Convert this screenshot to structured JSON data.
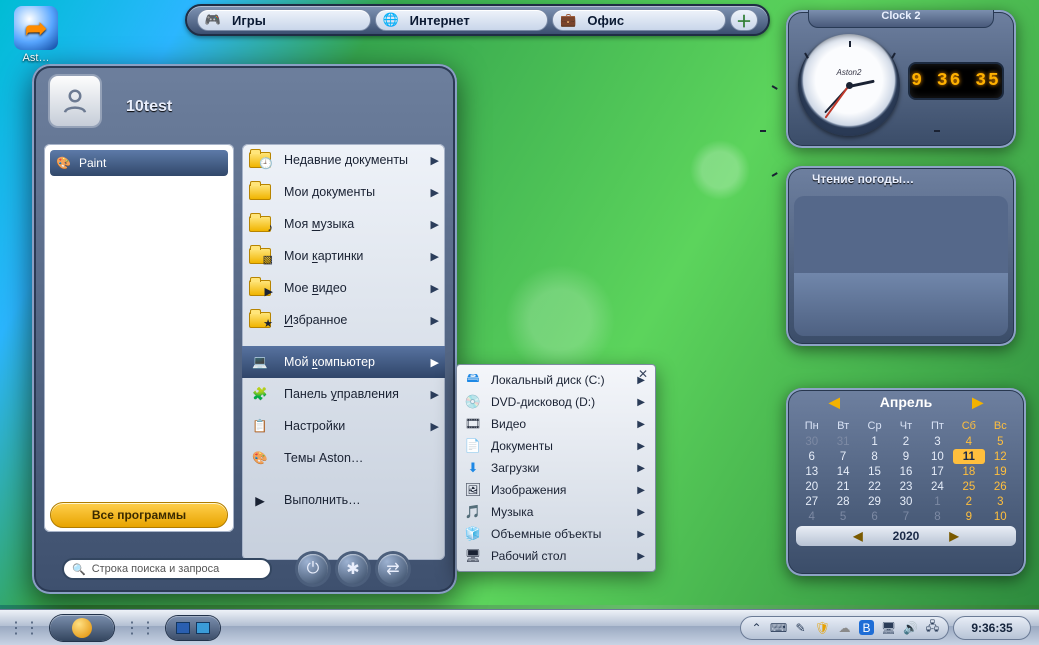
{
  "toolbar": {
    "items": [
      {
        "label": "Игры",
        "icon": "🎮"
      },
      {
        "label": "Интернет",
        "icon": "🌐"
      },
      {
        "label": "Офис",
        "icon": "💼"
      }
    ]
  },
  "desktop": {
    "icon0_label": "Ast…"
  },
  "start": {
    "username": "10test",
    "pinned": {
      "paint": "Paint"
    },
    "all_programs": "Все программы",
    "search_placeholder": "Строка поиска и запроса",
    "right": [
      {
        "label": "Недавние документы",
        "icon": "recent",
        "arrow": true
      },
      {
        "label": "Мои документы",
        "icon": "folder",
        "arrow": true
      },
      {
        "label": "Моя музыка",
        "u": "м",
        "rest": "узыка",
        "pre": "Моя ",
        "icon": "music",
        "arrow": true
      },
      {
        "label": "Мои картинки",
        "u": "к",
        "rest": "артинки",
        "pre": "Мои ",
        "icon": "pics",
        "arrow": true
      },
      {
        "label": "Мое видео",
        "u": "в",
        "rest": "идео",
        "pre": "Мое ",
        "icon": "video",
        "arrow": true
      },
      {
        "label": "Избранное",
        "u": "И",
        "rest": "збранное",
        "pre": "",
        "icon": "fav",
        "arrow": true
      },
      {
        "label": "Мой компьютер",
        "u": "к",
        "rest": "омпьютер",
        "pre": "Мой ",
        "icon": "pc",
        "arrow": true,
        "selected": true
      },
      {
        "label": "Панель управления",
        "u": "у",
        "rest": "правления",
        "pre": "Панель ",
        "icon": "cpl",
        "arrow": true
      },
      {
        "label": "Настройки",
        "icon": "settings",
        "arrow": true
      },
      {
        "label": "Темы Aston…",
        "icon": "themes",
        "arrow": false
      },
      {
        "label": "Выполнить…",
        "icon": "run",
        "arrow": false
      }
    ]
  },
  "submenu": {
    "items": [
      {
        "label": "Локальный диск (C:)",
        "icon": "🖴",
        "arrow": true,
        "color": "#1e88e5"
      },
      {
        "label": "DVD-дисковод (D:)",
        "icon": "💿",
        "arrow": true
      },
      {
        "label": "Видео",
        "icon": "🎞",
        "arrow": true
      },
      {
        "label": "Документы",
        "icon": "📄",
        "arrow": true
      },
      {
        "label": "Загрузки",
        "icon": "⬇",
        "arrow": true,
        "color": "#1e88e5"
      },
      {
        "label": "Изображения",
        "icon": "🖼",
        "arrow": true
      },
      {
        "label": "Музыка",
        "icon": "🎵",
        "arrow": true,
        "color": "#1e88e5"
      },
      {
        "label": "Объемные объекты",
        "icon": "🧊",
        "arrow": true
      },
      {
        "label": "Рабочий стол",
        "icon": "🖥",
        "arrow": true
      }
    ]
  },
  "clock": {
    "title": "Clock 2",
    "brand": "Aston2",
    "digital": "9 36 35"
  },
  "weather": {
    "title": "Чтение погоды…"
  },
  "calendar": {
    "month": "Апрель",
    "year": "2020",
    "dow": [
      "Пн",
      "Вт",
      "Ср",
      "Чт",
      "Пт",
      "Сб",
      "Вс"
    ],
    "rows": [
      [
        {
          "d": "30",
          "dim": true
        },
        {
          "d": "31",
          "dim": true
        },
        {
          "d": "1"
        },
        {
          "d": "2"
        },
        {
          "d": "3"
        },
        {
          "d": "4",
          "we": true
        },
        {
          "d": "5",
          "we": true
        }
      ],
      [
        {
          "d": "6"
        },
        {
          "d": "7"
        },
        {
          "d": "8"
        },
        {
          "d": "9"
        },
        {
          "d": "10"
        },
        {
          "d": "11",
          "we": true,
          "today": true
        },
        {
          "d": "12",
          "we": true
        }
      ],
      [
        {
          "d": "13"
        },
        {
          "d": "14"
        },
        {
          "d": "15"
        },
        {
          "d": "16"
        },
        {
          "d": "17"
        },
        {
          "d": "18",
          "we": true
        },
        {
          "d": "19",
          "we": true
        }
      ],
      [
        {
          "d": "20"
        },
        {
          "d": "21"
        },
        {
          "d": "22"
        },
        {
          "d": "23"
        },
        {
          "d": "24"
        },
        {
          "d": "25",
          "we": true
        },
        {
          "d": "26",
          "we": true
        }
      ],
      [
        {
          "d": "27"
        },
        {
          "d": "28"
        },
        {
          "d": "29"
        },
        {
          "d": "30"
        },
        {
          "d": "1",
          "dim": true
        },
        {
          "d": "2",
          "dim": true,
          "we": true
        },
        {
          "d": "3",
          "dim": true,
          "we": true
        }
      ],
      [
        {
          "d": "4",
          "dim": true
        },
        {
          "d": "5",
          "dim": true
        },
        {
          "d": "6",
          "dim": true
        },
        {
          "d": "7",
          "dim": true
        },
        {
          "d": "8",
          "dim": true
        },
        {
          "d": "9",
          "dim": true,
          "we": true
        },
        {
          "d": "10",
          "dim": true,
          "we": true
        }
      ]
    ]
  },
  "taskbar": {
    "clock": "9:36:35"
  }
}
